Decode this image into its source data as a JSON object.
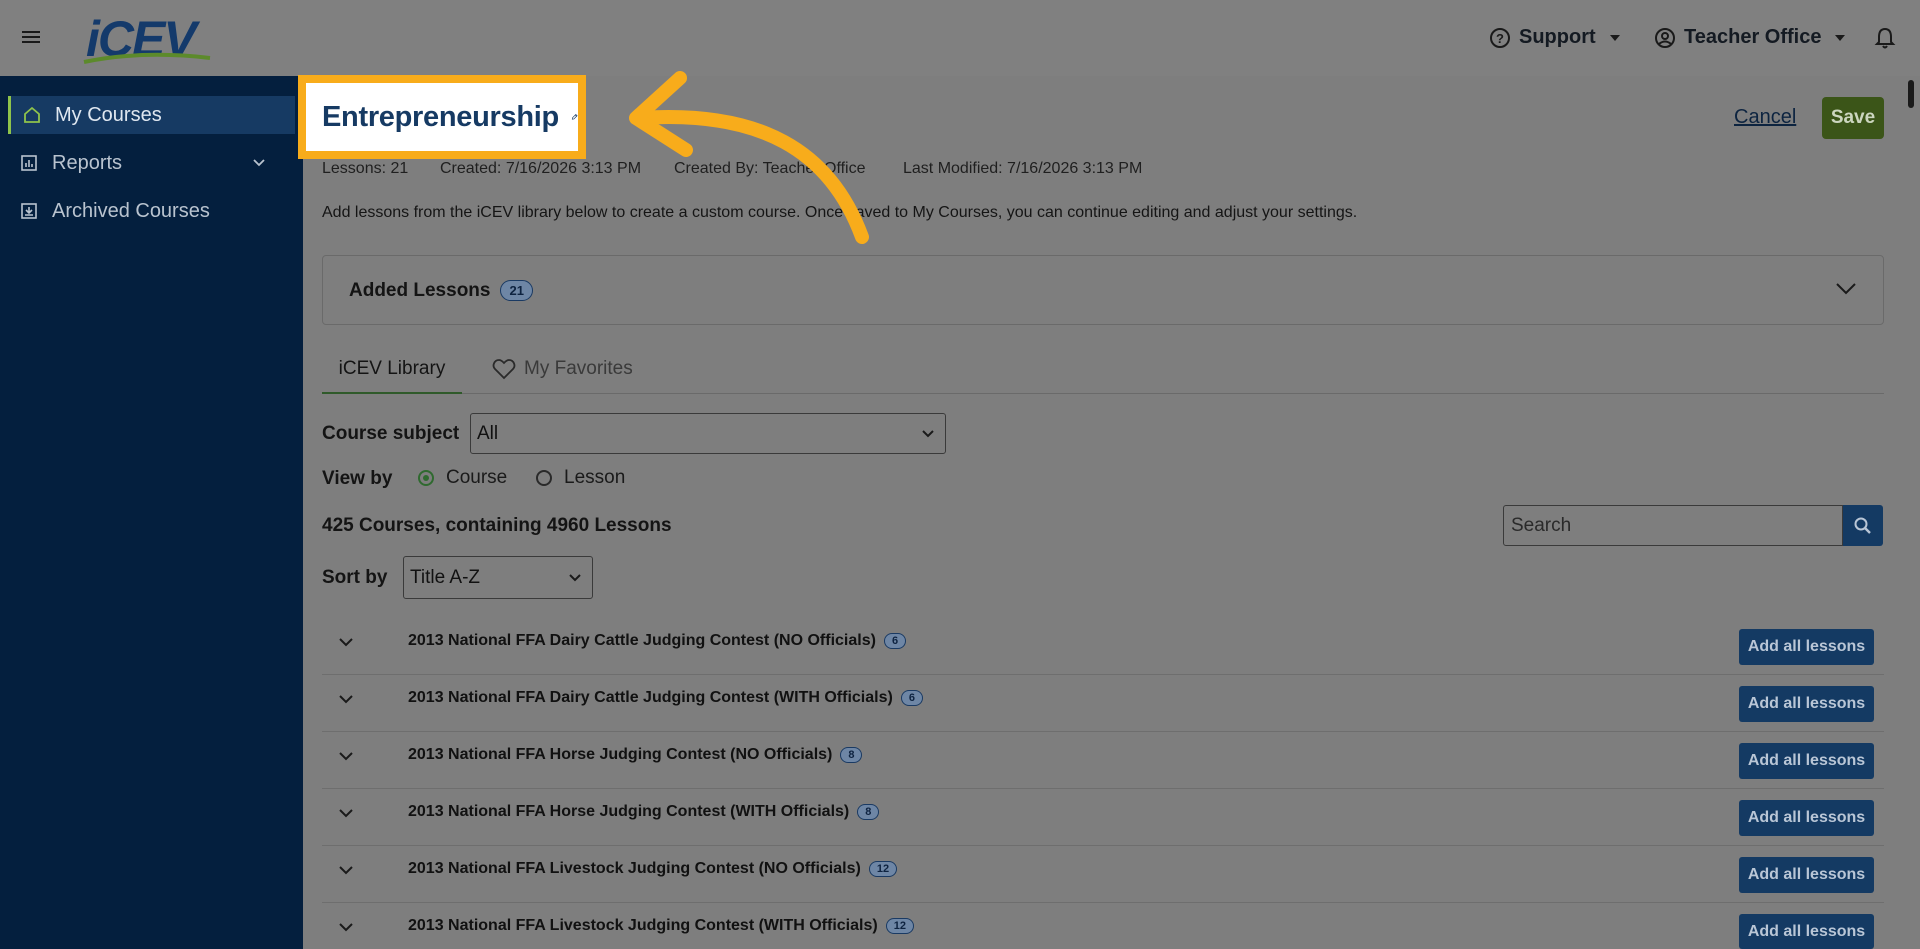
{
  "app": {
    "logo_text": "iCEV",
    "support_label": "Support",
    "account_label": "Teacher Office"
  },
  "sidebar": {
    "items": [
      {
        "label": "My Courses",
        "icon": "home-icon"
      },
      {
        "label": "Reports",
        "icon": "bar-chart-icon"
      },
      {
        "label": "Archived Courses",
        "icon": "archive-icon"
      }
    ]
  },
  "course": {
    "title": "Entrepreneurship",
    "lessons_meta": "Lessons: 21",
    "created_meta": "Created: 7/16/2026 3:13 PM",
    "created_by_meta": "Created By: Teacher Office",
    "modified_meta": "Last Modified: 7/16/2026 3:13 PM",
    "description": "Add lessons from the iCEV library below to create a custom course. Once saved to My Courses, you can continue editing and adjust your settings."
  },
  "actions": {
    "cancel_label": "Cancel",
    "save_label": "Save"
  },
  "added_lessons": {
    "label": "Added Lessons",
    "count": "21"
  },
  "tabs": [
    {
      "label": "iCEV Library"
    },
    {
      "label": "My Favorites"
    }
  ],
  "filters": {
    "course_subject_label": "Course subject",
    "course_subject_value": "All",
    "view_by_label": "View by",
    "view_by_options": [
      "Course",
      "Lesson"
    ],
    "view_by_selected": "Course",
    "summary": "425 Courses, containing 4960 Lessons",
    "search_placeholder": "Search",
    "sort_by_label": "Sort by",
    "sort_by_value": "Title A-Z"
  },
  "courses": [
    {
      "title": "2013 National FFA Dairy Cattle Judging Contest (NO Officials)",
      "count": "6",
      "action": "Add all lessons"
    },
    {
      "title": "2013 National FFA Dairy Cattle Judging Contest (WITH Officials)",
      "count": "6",
      "action": "Add all lessons"
    },
    {
      "title": "2013 National FFA Horse Judging Contest (NO Officials)",
      "count": "8",
      "action": "Add all lessons"
    },
    {
      "title": "2013 National FFA Horse Judging Contest (WITH Officials)",
      "count": "8",
      "action": "Add all lessons"
    },
    {
      "title": "2013 National FFA Livestock Judging Contest (NO Officials)",
      "count": "12",
      "action": "Add all lessons"
    },
    {
      "title": "2013 National FFA Livestock Judging Contest (WITH Officials)",
      "count": "12",
      "action": "Add all lessons"
    }
  ],
  "colors": {
    "highlight": "#f8ac1b",
    "navy": "#143a63",
    "save_green": "#3b5518"
  }
}
